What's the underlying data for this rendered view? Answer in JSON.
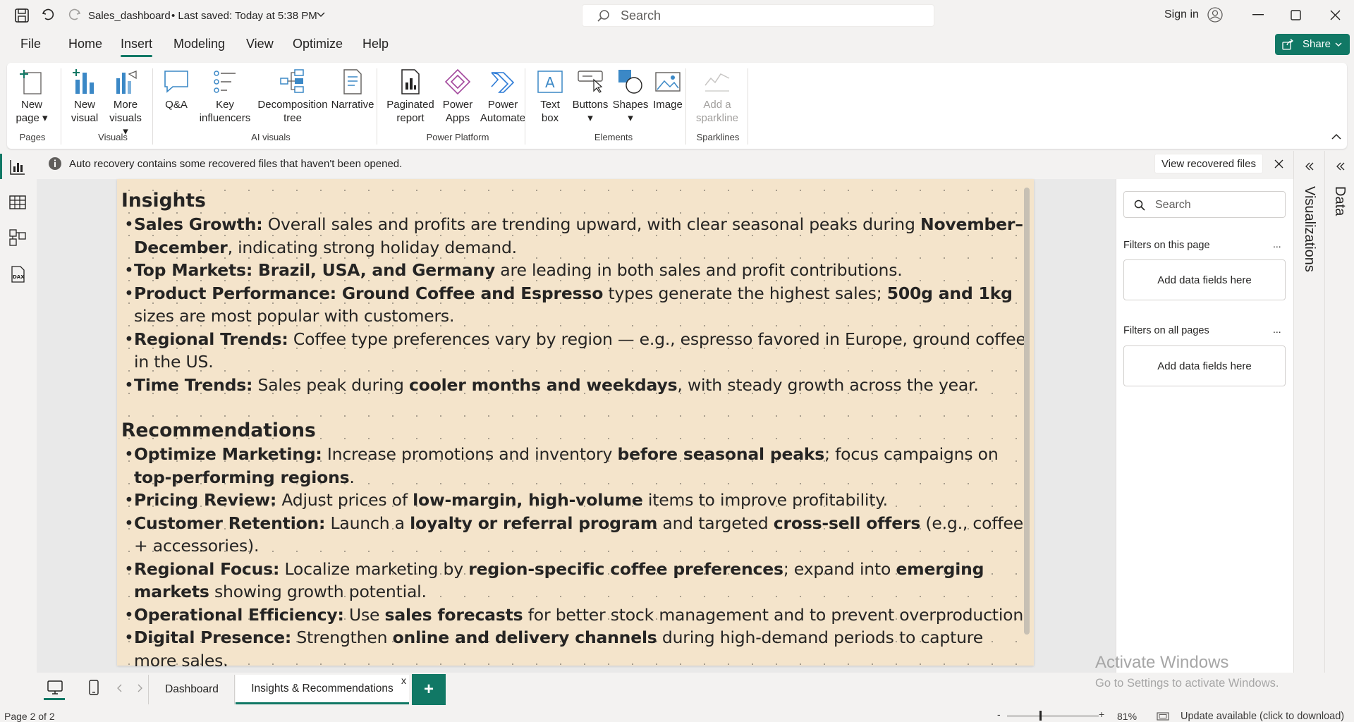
{
  "titlebar": {
    "filename": "Sales_dashboard",
    "saved": "• Last saved: Today at 5:38 PM",
    "search_placeholder": "Search",
    "sign_in": "Sign in"
  },
  "menu": {
    "tabs": [
      "File",
      "Home",
      "Insert",
      "Modeling",
      "View",
      "Optimize",
      "Help"
    ],
    "active": "Insert",
    "share": "Share"
  },
  "ribbon": {
    "new_page": [
      "New",
      "page"
    ],
    "new_visual": [
      "New",
      "visual"
    ],
    "more_visuals": [
      "More",
      "visuals"
    ],
    "qa": "Q&A",
    "key_influencers": [
      "Key",
      "influencers"
    ],
    "decomposition_tree": [
      "Decomposition",
      "tree"
    ],
    "narrative": "Narrative",
    "paginated_report": [
      "Paginated",
      "report"
    ],
    "power_apps": [
      "Power",
      "Apps"
    ],
    "power_automate": [
      "Power",
      "Automate"
    ],
    "text_box": [
      "Text",
      "box"
    ],
    "buttons": "Buttons",
    "shapes": "Shapes",
    "image": "Image",
    "add_sparkline": [
      "Add a",
      "sparkline"
    ],
    "groups": {
      "pages": "Pages",
      "visuals": "Visuals",
      "ai_visuals": "AI visuals",
      "power_platform": "Power Platform",
      "elements": "Elements",
      "sparklines": "Sparklines"
    }
  },
  "notification": {
    "text": "Auto recovery contains some recovered files that haven't been opened.",
    "button": "View recovered files"
  },
  "report": {
    "insights_title": "Insights",
    "recommendations_title": "Recommendations"
  },
  "filters": {
    "search_placeholder": "Search",
    "this_page": "Filters on this page",
    "all_pages": "Filters on all pages",
    "add_fields_1": "Add data fields here",
    "add_fields_2": "Add data fields here",
    "more": "...",
    "more2": "..."
  },
  "side_tabs": {
    "visualizations": "Visualizations",
    "data": "Data"
  },
  "pages": {
    "tabs": [
      "Dashboard",
      "Insights & Recommendations"
    ],
    "active": "Insights & Recommendations",
    "close": "x",
    "add": "+"
  },
  "watermark": {
    "line1": "Activate Windows",
    "line2": "Go to Settings to activate Windows."
  },
  "status": {
    "page": "Page 2 of 2",
    "zoom": "81%",
    "minus": "-",
    "plus": "+",
    "update": "Update available (click to download)"
  },
  "colors": {
    "accent": "#117865",
    "report_bg": "#f4e4cb",
    "ribbon_blue": "#3b88c6"
  }
}
